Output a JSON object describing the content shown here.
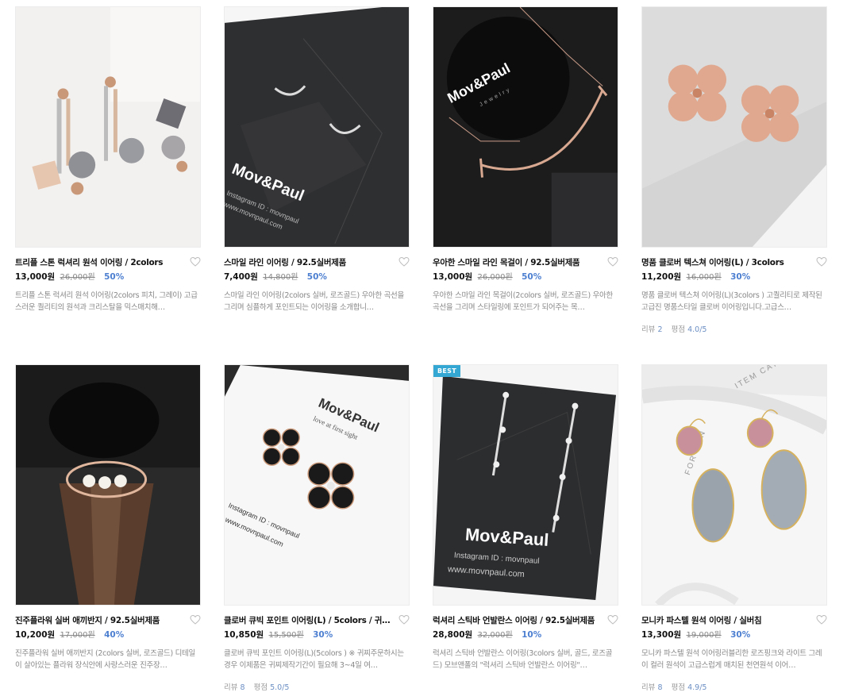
{
  "products": [
    {
      "title": "트리플 스톤 럭셔리 원석 이어링 / 2colors",
      "price": "13,000원",
      "original": "26,000원",
      "discount": "50%",
      "desc": "트리플 스톤 럭셔리 원석 이어링(2colors 피치, 그레이) 고급스러운 퀄리티의 원석과 크리스탈을 믹스매치해…",
      "image": "stone-drop-earrings"
    },
    {
      "title": "스마일 라인 이어링 / 92.5실버제품",
      "price": "7,400원",
      "original": "14,800원",
      "discount": "50%",
      "desc": "스마일 라인 이어링(2colors 실버, 로즈골드) 우아한 곡선을 그리며 심플하게 포인트되는 이어링을 소개합니…",
      "image": "smile-line-earrings"
    },
    {
      "title": "우아한 스마일 라인 목걸이 / 92.5실버제품",
      "price": "13,000원",
      "original": "26,000원",
      "discount": "50%",
      "desc": "우아한 스마일 라인 목걸이(2colors 실버, 로즈골드) 우아한 곡선을 그리며 스타일링에 포인트가 되어주는 목…",
      "image": "smile-line-necklace"
    },
    {
      "title": "명품 클로버 텍스쳐 이어링(L) / 3colors",
      "price": "11,200원",
      "original": "16,000원",
      "discount": "30%",
      "desc": "명품 클로버 텍스쳐 이어링(L)(3colors ) 고퀄리티로 제작된 고급진 명품스타일 클로버 이어링입니다.고급스…",
      "image": "clover-texture-earrings",
      "review_label": "리뷰",
      "review_count": "2",
      "rating_label": "평점",
      "rating": "4.0/5"
    },
    {
      "title": "진주플라워 실버 애끼반지 / 92.5실버제품",
      "price": "10,200원",
      "original": "17,000원",
      "discount": "40%",
      "desc": "진주플라워 실버 애끼반지 (2colors 실버, 로즈골드) 디테일이 살아있는 플라워 장식안에 사랑스러운 진주장…",
      "image": "pearl-flower-ring"
    },
    {
      "title": "클로버 큐빅 포인트 이어링(L) / 5colors / 귀찌…",
      "price": "10,850원",
      "original": "15,500원",
      "discount": "30%",
      "desc": "클로버 큐빅 포인트 이어링(L)(5colors ) ※ 귀찌주문하시는 경우 이제품은 귀찌제작기간이 필요해 3~4일 여…",
      "image": "clover-cubic-earrings",
      "review_label": "리뷰",
      "review_count": "8",
      "rating_label": "평점",
      "rating": "5.0/5"
    },
    {
      "title": "럭셔리 스틱바 언발란스 이어링 / 92.5실버제품",
      "price": "28,800원",
      "original": "32,000원",
      "discount": "10%",
      "desc": "럭셔리 스틱바 언발란스 이어링(3colors 실버, 골드, 로즈골드) 모브앤폴의 \"럭셔리 스틱바 언발란스 이어링\"…",
      "image": "stick-bar-earrings",
      "badge": "BEST"
    },
    {
      "title": "모니카 파스텔 원석 이어링 / 실버침",
      "price": "13,300원",
      "original": "19,000원",
      "discount": "30%",
      "desc": "모니카 파스텔 원석 이어링러블리한 로즈핑크와 라이트 그레이 컬러 원석이 고급스럽게 매치된 천연원석 이어…",
      "image": "pastel-stone-earrings",
      "review_label": "리뷰",
      "review_count": "8",
      "rating_label": "평점",
      "rating": "4.9/5"
    }
  ],
  "colors": {
    "discount": "#4d7fd1",
    "badge": "#34a8d2",
    "rating": "#6c8fc4"
  }
}
